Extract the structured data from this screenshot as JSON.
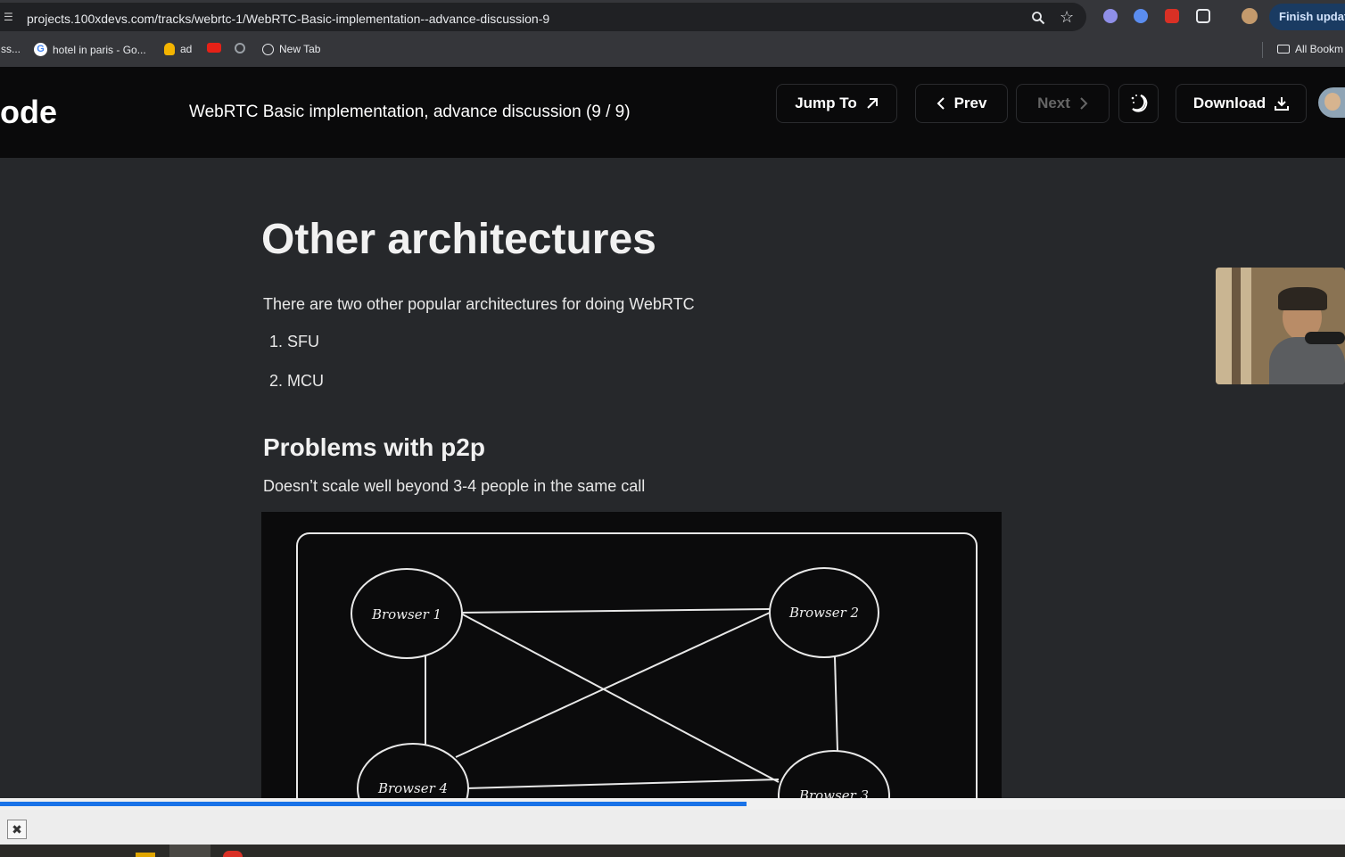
{
  "browser": {
    "url": "projects.100xdevs.com/tracks/webrtc-1/WebRTC-Basic-implementation--advance-discussion-9",
    "finish_update_label": "Finish update",
    "bookmarks": [
      "ss...",
      "hotel in paris - Go...",
      "ad",
      "New Tab"
    ],
    "all_bookmarks_label": "All Bookm"
  },
  "header": {
    "brand": "ode",
    "lesson_title": "WebRTC Basic implementation, advance discussion (9 / 9)",
    "jump_to_label": "Jump To",
    "prev_label": "Prev",
    "next_label": "Next",
    "download_label": "Download"
  },
  "article": {
    "title": "Other architectures",
    "intro": "There are two other popular architectures for doing WebRTC",
    "list": [
      "1. SFU",
      "2. MCU"
    ],
    "section_title": "Problems with p2p",
    "section_text": "Doesn’t scale well beyond 3-4 people in the same call",
    "diagram_nodes": [
      "Browser 1",
      "Browser 2",
      "Browser 4",
      "Browser 3"
    ]
  },
  "video": {
    "progress": 0.555
  }
}
